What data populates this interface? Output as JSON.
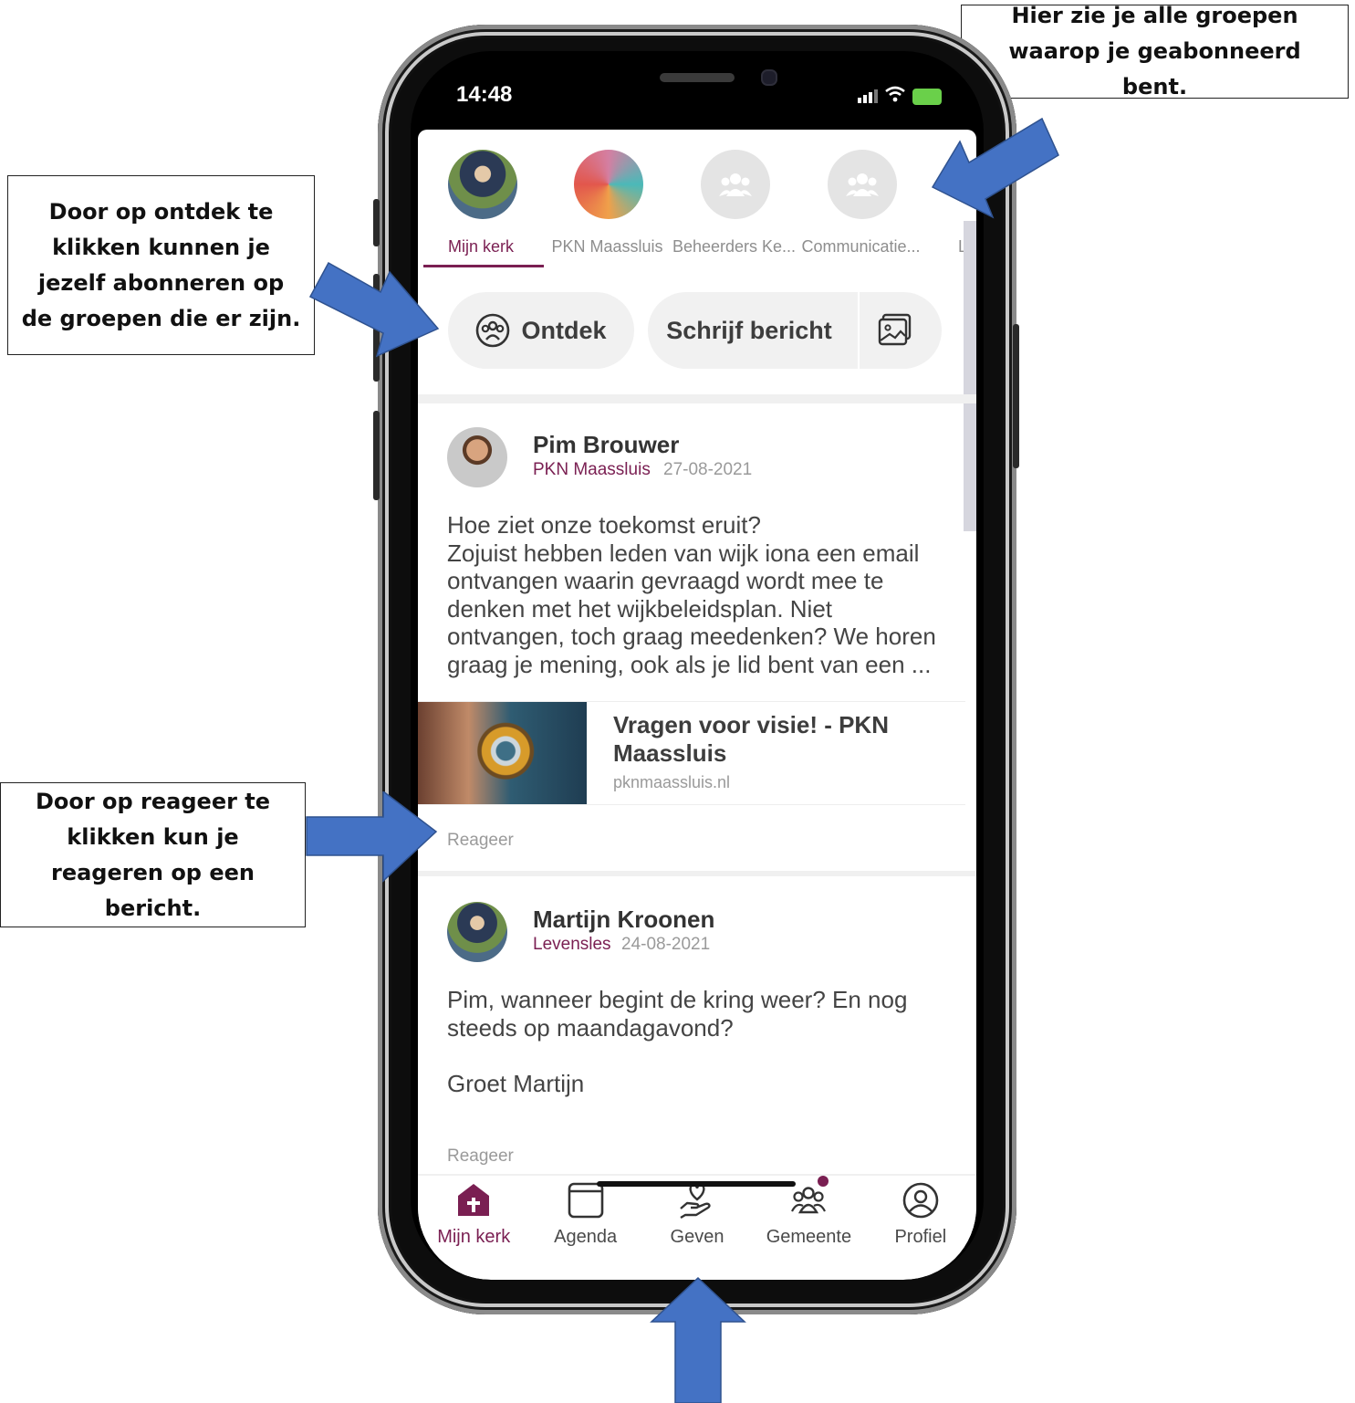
{
  "callouts": {
    "top": "Hier zie je alle groepen waarop je geabonneerd bent.",
    "left1": "Door op ontdek te klikken kunnen je jezelf abonneren op de groepen die er zijn.",
    "left2": "Door op reageer te klikken kun je reageren op een bericht."
  },
  "status": {
    "time": "14:48"
  },
  "groups": [
    {
      "label": "Mijn kerk",
      "active": true
    },
    {
      "label": "PKN Maassluis"
    },
    {
      "label": "Beheerders Ke..."
    },
    {
      "label": "Communicatie..."
    },
    {
      "label": "Lie"
    }
  ],
  "actions": {
    "discover": "Ontdek",
    "write": "Schrijf bericht"
  },
  "posts": [
    {
      "author": "Pim Brouwer",
      "group": "PKN Maassluis",
      "date": "27-08-2021",
      "body": "Hoe ziet onze toekomst eruit?\nZojuist hebben leden van wijk iona een email ontvangen waarin gevraagd wordt mee te denken met het wijkbeleidsplan. Niet ontvangen, toch graag meedenken? We horen graag je mening, ook als je lid bent van een ...",
      "link": {
        "title": "Vragen voor visie! - PKN Maassluis",
        "domain": "pknmaassluis.nl"
      },
      "reply": "Reageer"
    },
    {
      "author": "Martijn Kroonen",
      "group": "Levensles",
      "date": "24-08-2021",
      "body": "Pim, wanneer begint de kring weer? En nog steeds op maandagavond?\n\nGroet Martijn",
      "reply": "Reageer"
    }
  ],
  "tabs": [
    {
      "label": "Mijn kerk",
      "icon": "church-home-icon",
      "active": true
    },
    {
      "label": "Agenda",
      "icon": "calendar-icon"
    },
    {
      "label": "Geven",
      "icon": "heart-hand-icon"
    },
    {
      "label": "Gemeente",
      "icon": "people-icon"
    },
    {
      "label": "Profiel",
      "icon": "profile-icon"
    }
  ],
  "colors": {
    "accent": "#7a1f52",
    "arrow": "#4472c4"
  }
}
